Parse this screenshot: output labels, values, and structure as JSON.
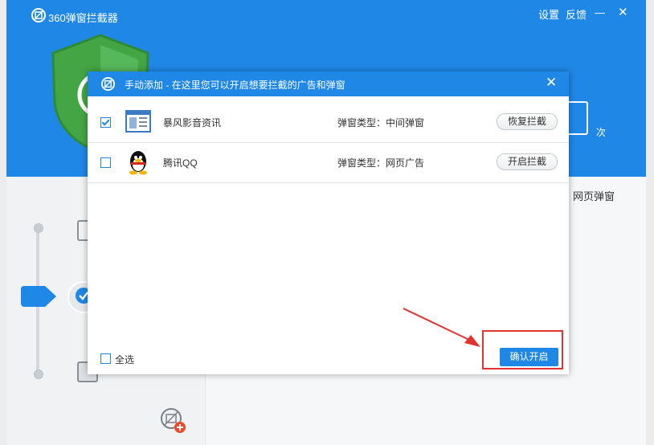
{
  "app": {
    "title": "360弹窗拦截器",
    "settings_label": "设置",
    "feedback_label": "反馈",
    "minimize_label": "—",
    "close_label": "✕",
    "count_unit": "次",
    "right_label": "网页弹窗"
  },
  "dialog": {
    "title": "手动添加 - 在这里您可以开启想要拦截的广告和弹窗",
    "close_label": "✕",
    "rows": [
      {
        "checked": true,
        "icon": "storm-video-news-icon",
        "name": "暴风影音资讯",
        "type": "弹窗类型：中间弹窗",
        "action": "恢复拦截"
      },
      {
        "checked": false,
        "icon": "qq-penguin-icon",
        "name": "腾讯QQ",
        "type": "弹窗类型：网页广告",
        "action": "开启拦截"
      }
    ],
    "select_all_label": "全选",
    "confirm_label": "确认开启"
  },
  "colors": {
    "accent": "#1f87e5",
    "highlight": "#e23333",
    "shield": "#43a544"
  }
}
